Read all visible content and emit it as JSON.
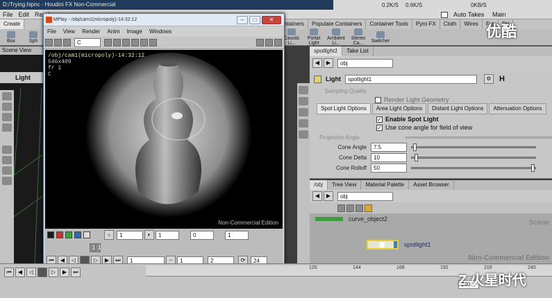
{
  "window": {
    "title": "D:/Trying.hipnc - Houdini FX Non-Commercial"
  },
  "network_monitor": {
    "download": "0.2K/S",
    "upload": "0.6K/S",
    "other": "0KB/S",
    "auto_takes": "Auto Takes",
    "desktop": "Main"
  },
  "menu": [
    "File",
    "Edit",
    "Rend"
  ],
  "shelf": {
    "tabs": [
      "Create",
      "ontainers",
      "Populate Containers",
      "Container Tools",
      "Pyro FX",
      "Cloth",
      "Wires",
      "Fur",
      "Dri"
    ],
    "tools": [
      "Box",
      "Sph",
      "Caustic Li...",
      "Portal Light",
      "Ambient Li...",
      "Stereo Ca...",
      "Switcher"
    ]
  },
  "scene": {
    "tab": "Scene View",
    "tool_label": "Light"
  },
  "mplay": {
    "title": "MPlay - /obj/cam1(micropoly)-14:32:12",
    "menu": [
      "File",
      "View",
      "Render",
      "Anim",
      "Image",
      "Windows"
    ],
    "channel": "C",
    "info_line1": "/obj/cam1(micropoly)-14:32:12",
    "info_line2": "546x409",
    "info_line3": "fr 1",
    "info_line4": "C",
    "watermark": "Non-Commercial Edition",
    "ctrl1": {
      "f1": "1",
      "f2": "1",
      "f3": "0",
      "f4": "1"
    },
    "frames": {
      "start": "1",
      "end": "1",
      "step": "2",
      "current": "24"
    },
    "frame_markers": [
      "1",
      "1"
    ]
  },
  "params": {
    "tabs": [
      "spotlight1",
      "Take List"
    ],
    "path": "obj",
    "node_type": "Light",
    "node_name": "spotlight1",
    "sampling_quality": "Sampling Quality",
    "render_geo": "Render Light Geometry",
    "subtabs": [
      "Spot Light Options",
      "Area Light Options",
      "Distant Light Options",
      "Attenuation Options"
    ],
    "enable_spot": "Enable Spot Light",
    "use_cone": "Use cone angle for field of view",
    "projection_angle": "Projection Angle",
    "cone_angle_label": "Cone Angle",
    "cone_angle": "7.5",
    "cone_delta_label": "Cone Delta",
    "cone_delta": "10",
    "cone_rolloff_label": "Cone Rolloff",
    "cone_rolloff": "50"
  },
  "network": {
    "tabs": [
      "/obj",
      "Tree View",
      "Material Palette",
      "Asset Browser"
    ],
    "path": "obj",
    "node1": "curve_object2",
    "node2": "spotlight1",
    "scene_label": "Scene",
    "watermark": "Non-Commercial Edition"
  },
  "timeline": {
    "ticks": [
      "120",
      "144",
      "168",
      "192",
      "216",
      "240"
    ],
    "end_frame": "240"
  },
  "watermarks": {
    "top": "优酷",
    "bottom": "Z 火星时代"
  }
}
